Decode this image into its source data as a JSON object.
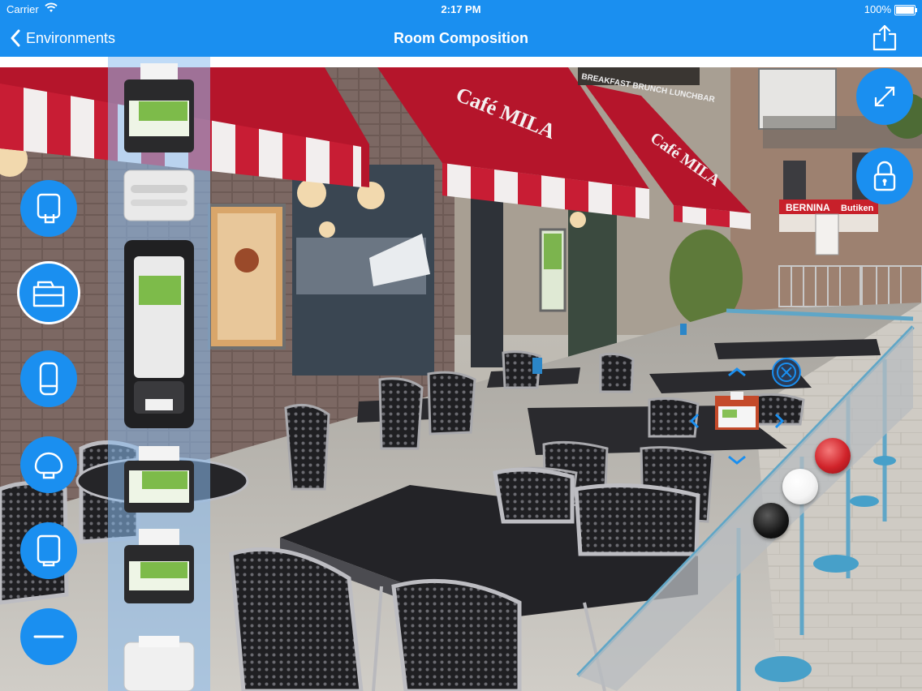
{
  "status_bar": {
    "carrier": "Carrier",
    "time": "2:17 PM",
    "battery": "100%"
  },
  "nav": {
    "back_label": "Environments",
    "title": "Room Composition"
  },
  "scene": {
    "signs": {
      "cafe_awning": "Café MILA",
      "cafe_awning_2": "Café MILA",
      "breakfast_sign": "BREAKFAST BRUNCH LUNCHBAR",
      "bernina": "BERNINA",
      "butiken": "Butiken"
    }
  },
  "toolbar": {
    "items": [
      {
        "icon": "hand-towel-dispenser-icon"
      },
      {
        "icon": "napkin-dispenser-icon"
      },
      {
        "icon": "roll-dispenser-icon"
      },
      {
        "icon": "toilet-roll-dispenser-icon"
      },
      {
        "icon": "folded-towel-dispenser-icon"
      },
      {
        "icon": "minus-icon"
      }
    ]
  },
  "right_controls": {
    "expand_icon": "expand-icon",
    "lock_icon": "lock-icon"
  },
  "color_swatches": [
    {
      "name": "red",
      "color": "#d0232a"
    },
    {
      "name": "white",
      "color": "#f4f4f4"
    },
    {
      "name": "black",
      "color": "#151515"
    }
  ],
  "colors": {
    "accent": "#1a8ff0",
    "awning_red": "#b5152b"
  }
}
